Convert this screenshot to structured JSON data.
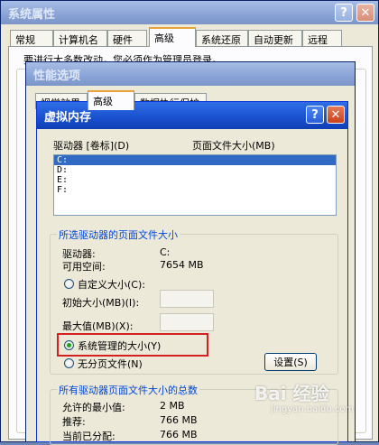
{
  "sys_props": {
    "title": "系统属性",
    "help": "?",
    "close": "✕",
    "tabs": [
      "常规",
      "计算机名",
      "硬件",
      "高级",
      "系统还原",
      "自动更新",
      "远程"
    ],
    "notice": "要进行大多数改动，您必须作为管理员登录。"
  },
  "perf": {
    "title": "性能选项",
    "tabs": [
      "视觉效果",
      "高级",
      "数据执行保护"
    ]
  },
  "vmem": {
    "title": "虚拟内存",
    "help": "?",
    "close": "✕",
    "col_drive": "驱动器 [卷标](D)",
    "col_size": "页面文件大小(MB)",
    "drives": [
      "C:",
      "D:",
      "E:",
      "F:"
    ],
    "selected": {
      "title": "所选驱动器的页面文件大小",
      "drive_label": "驱动器:",
      "drive_value": "C:",
      "space_label": "可用空间:",
      "space_value": "7654 MB",
      "custom_size": "自定义大小(C):",
      "initial_size": "初始大小(MB)(I):",
      "max_size": "最大值(MB)(X):",
      "system_managed": "系统管理的大小(Y)",
      "no_paging": "无分页文件(N)",
      "set_button": "设置(S)"
    },
    "total": {
      "title": "所有驱动器页面文件大小的总数",
      "min_label": "允许的最小值:",
      "min_value": "2 MB",
      "rec_label": "推荐:",
      "rec_value": "766 MB",
      "cur_label": "当前已分配:",
      "cur_value": "766 MB"
    }
  },
  "watermark": {
    "brand": "Bai 经验",
    "url": "jingyan.baidu.com"
  }
}
